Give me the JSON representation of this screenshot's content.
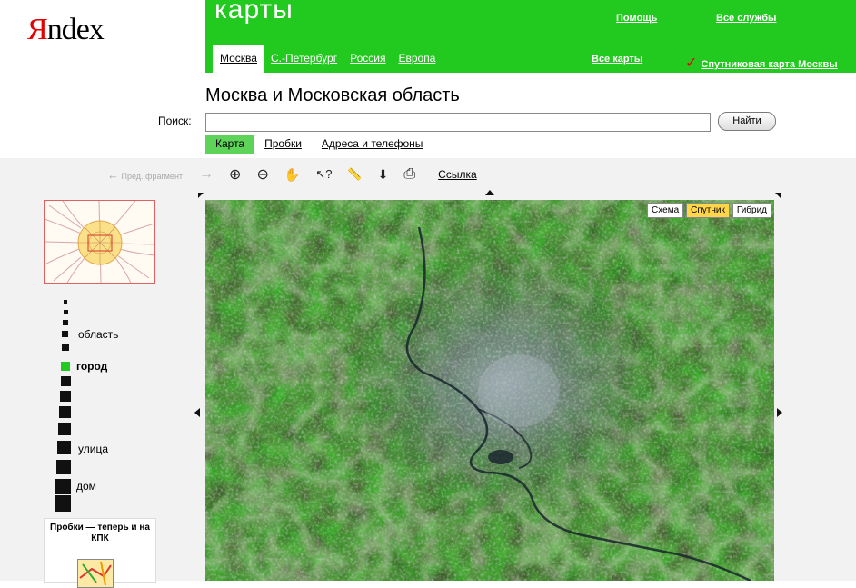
{
  "logo": {
    "first": "Я",
    "rest": "ndex"
  },
  "header": {
    "brand": "карты",
    "help": "Помощь",
    "all_services": "Все службы",
    "tabs": [
      {
        "label": "Москва",
        "active": true
      },
      {
        "label": "С.-Петербург",
        "active": false
      },
      {
        "label": "Россия",
        "active": false
      },
      {
        "label": "Европа",
        "active": false
      }
    ],
    "all_maps": "Все карты",
    "satellite_map": "Спутниковая карта Москвы",
    "checkmark": "✓",
    "color": "#22c91e"
  },
  "region_title": "Москва и Московская область",
  "search": {
    "label": "Поиск:",
    "value": "",
    "button": "Найти"
  },
  "subtabs": [
    {
      "label": "Карта",
      "active": true
    },
    {
      "label": "Пробки",
      "active": false
    },
    {
      "label": "Адреса и телефоны",
      "active": false
    }
  ],
  "toolbar": {
    "prev_fragment": "Пред. фрагмент",
    "prev_icon": "←",
    "next_icon": "→",
    "tools": [
      {
        "name": "zoom-in-icon",
        "glyph": "⊕"
      },
      {
        "name": "zoom-out-icon",
        "glyph": "⊖"
      },
      {
        "name": "hand-icon",
        "glyph": "✋"
      },
      {
        "name": "info-cursor-icon",
        "glyph": "↖?"
      },
      {
        "name": "ruler-icon",
        "glyph": "📏"
      },
      {
        "name": "pin-icon",
        "glyph": "⬇"
      },
      {
        "name": "print-icon",
        "glyph": "⎙"
      }
    ],
    "link": "Ссылка"
  },
  "zoom_scale": {
    "labels": {
      "region": "область",
      "city": "город",
      "street": "улица",
      "house": "дом"
    },
    "current_level": "город"
  },
  "promo": {
    "text": "Пробки — теперь и на КПК"
  },
  "map": {
    "modes": [
      {
        "label": "Схема",
        "active": false
      },
      {
        "label": "Спутник",
        "active": true
      },
      {
        "label": "Гибрид",
        "active": false
      }
    ]
  }
}
